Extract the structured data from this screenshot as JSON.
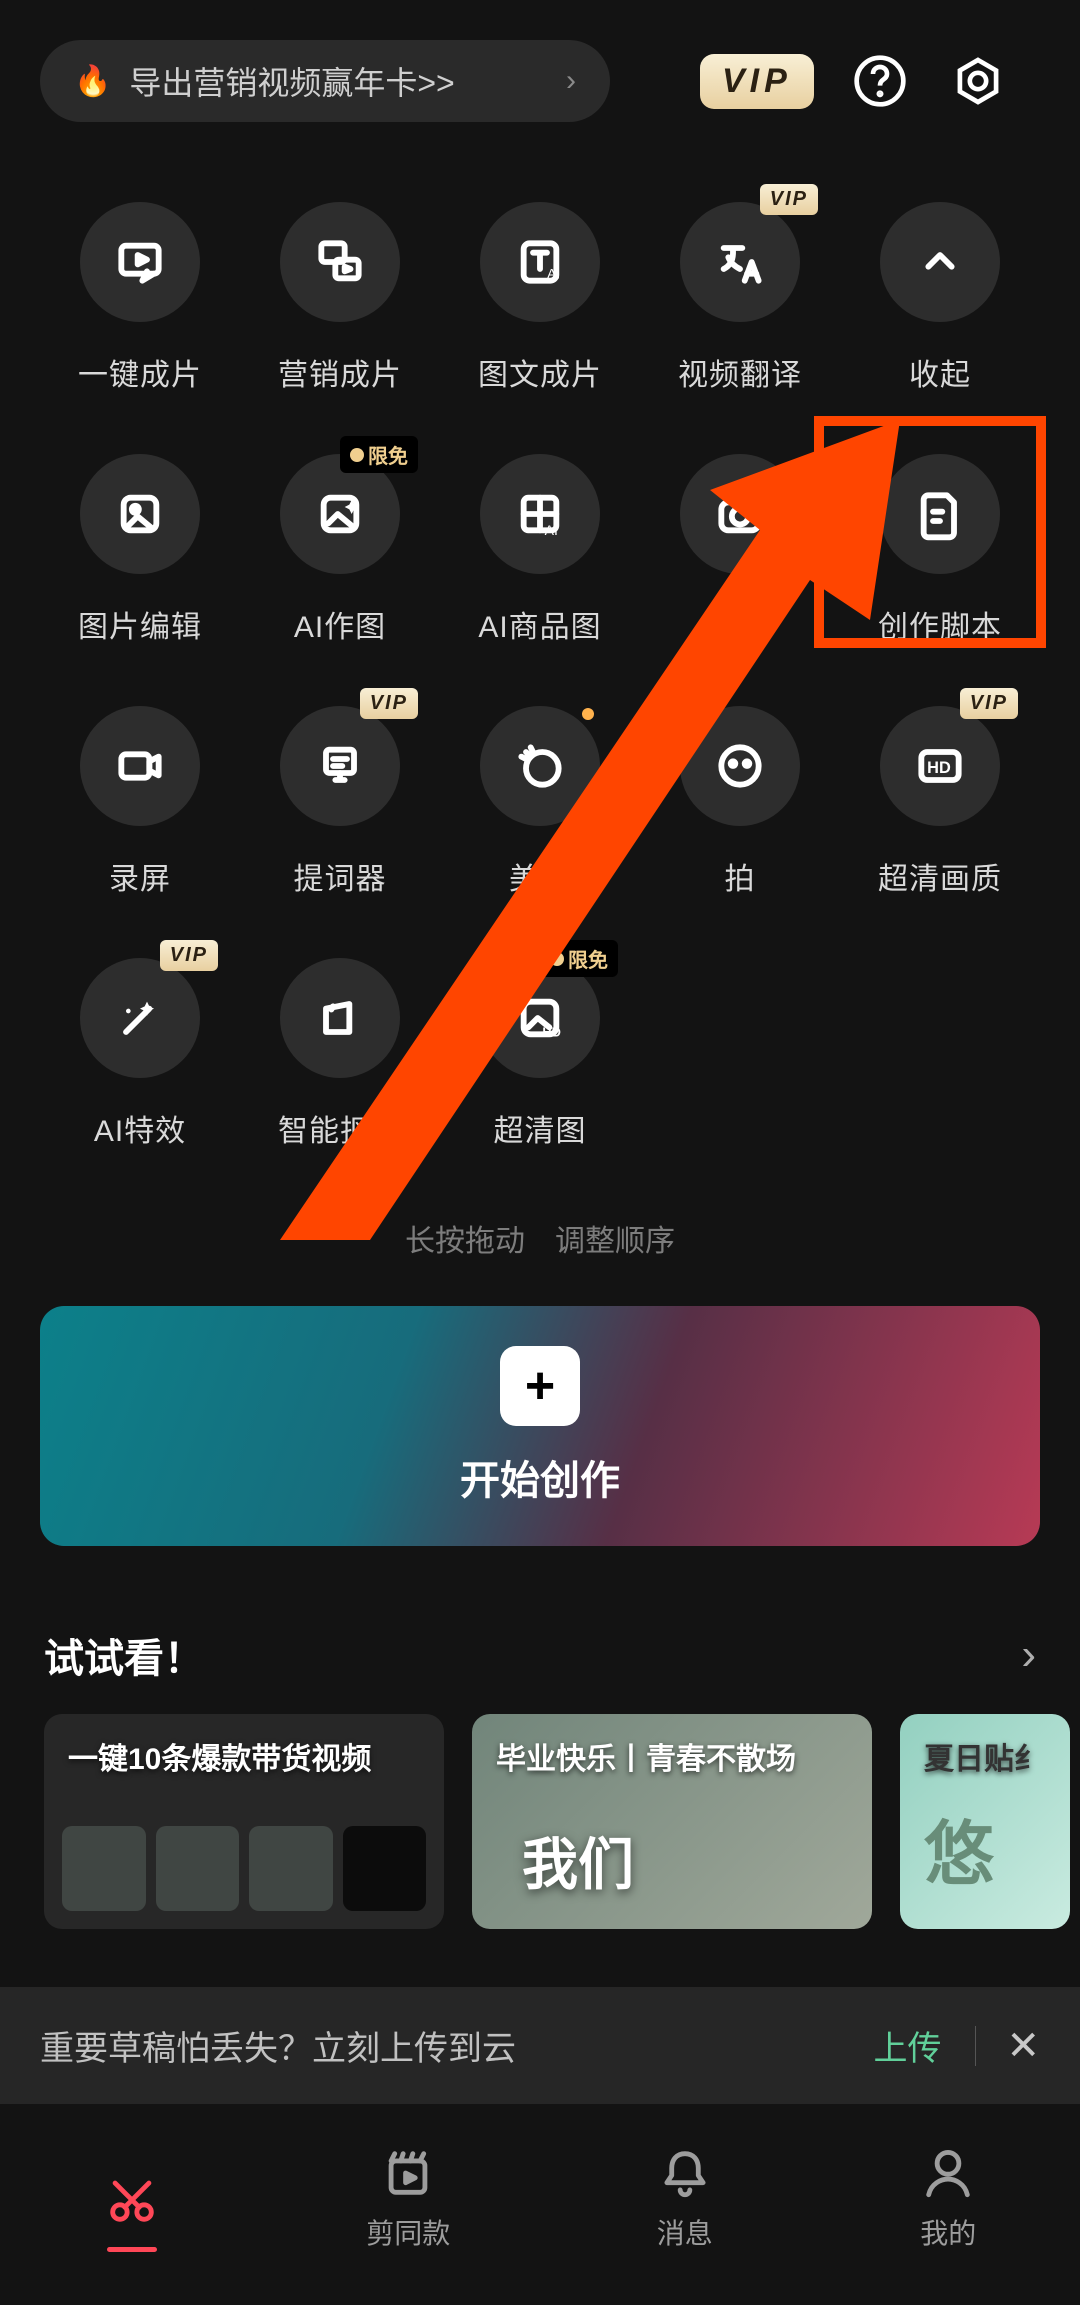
{
  "header": {
    "promo_text": "导出营销视频赢年卡>>",
    "vip_label": "VIP"
  },
  "tools": {
    "row1": [
      {
        "label": "一键成片",
        "icon": "video-flash",
        "badge": null
      },
      {
        "label": "营销成片",
        "icon": "video-multi",
        "badge": null
      },
      {
        "label": "图文成片",
        "icon": "text-ai",
        "badge": null
      },
      {
        "label": "视频翻译",
        "icon": "translate",
        "badge": "vip"
      },
      {
        "label": "收起",
        "icon": "chev-up",
        "badge": null
      }
    ],
    "row2": [
      {
        "label": "图片编辑",
        "icon": "image-edit",
        "badge": null
      },
      {
        "label": "AI作图",
        "icon": "image-sparkle",
        "badge": "free"
      },
      {
        "label": "AI商品图",
        "icon": "grid-ai",
        "badge": null
      },
      {
        "label": "拍摄",
        "icon": "camera",
        "badge": null
      },
      {
        "label": "创作脚本",
        "icon": "doc",
        "badge": null
      }
    ],
    "row3": [
      {
        "label": "录屏",
        "icon": "record",
        "badge": null
      },
      {
        "label": "提词器",
        "icon": "teleprompter",
        "badge": "vip"
      },
      {
        "label": "美颜",
        "icon": "beauty",
        "badge": null,
        "dot": true
      },
      {
        "label": "拍",
        "icon": "face",
        "badge": null
      },
      {
        "label": "超清画质",
        "icon": "hd",
        "badge": "vip"
      }
    ],
    "row4": [
      {
        "label": "AI特效",
        "icon": "wand",
        "badge": "vip"
      },
      {
        "label": "智能抠图",
        "icon": "cutout",
        "badge": null
      },
      {
        "label": "超清图",
        "icon": "image-hd",
        "badge": "free"
      }
    ],
    "badge_vip": "VIP",
    "badge_free": "限免",
    "hint": "长按拖动 调整顺序"
  },
  "start_create": {
    "label": "开始创作"
  },
  "try_section": {
    "title": "试试看！",
    "cards": [
      {
        "title": "一键10条爆款带货视频",
        "big": ""
      },
      {
        "title": "毕业快乐丨青春不散场",
        "big": "我们"
      },
      {
        "title": "夏日贴纟",
        "big": "悠"
      }
    ]
  },
  "upload_banner": {
    "text": "重要草稿怕丢失？立刻上传到云",
    "link": "上传"
  },
  "bottom_nav": {
    "items": [
      "剪辑",
      "剪同款",
      "消息",
      "我的"
    ]
  }
}
